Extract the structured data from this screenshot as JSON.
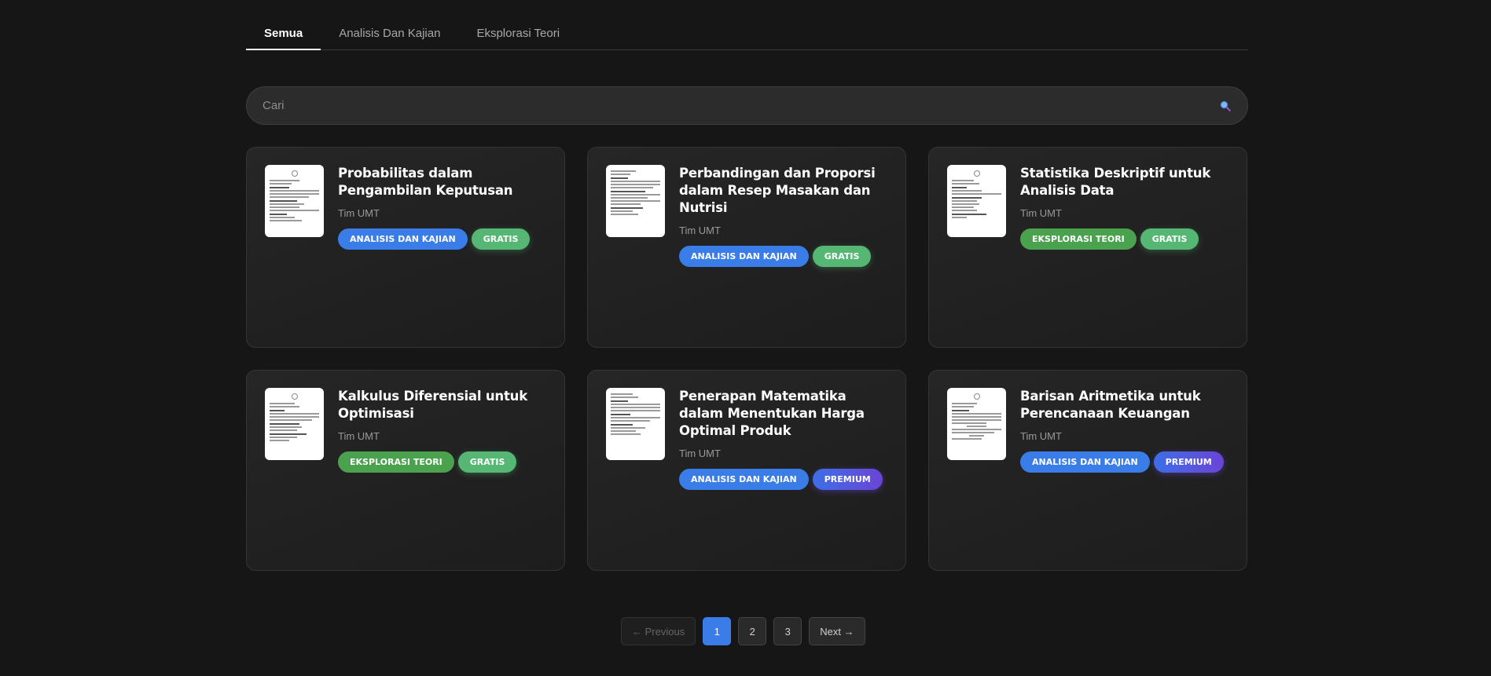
{
  "tabs": [
    {
      "label": "Semua"
    },
    {
      "label": "Analisis Dan Kajian"
    },
    {
      "label": "Eksplorasi Teori"
    }
  ],
  "search": {
    "placeholder": "Cari"
  },
  "cards": [
    {
      "title": "Probabilitas dalam Pengambilan Keputusan",
      "author": "Tim UMT",
      "category": "ANALISIS DAN KAJIAN",
      "price": "GRATIS"
    },
    {
      "title": "Perbandingan dan Proporsi dalam Resep Masakan dan Nutrisi",
      "author": "Tim UMT",
      "category": "ANALISIS DAN KAJIAN",
      "price": "GRATIS"
    },
    {
      "title": "Statistika Deskriptif untuk Analisis Data",
      "author": "Tim UMT",
      "category": "EKSPLORASI TEORI",
      "price": "GRATIS"
    },
    {
      "title": "Kalkulus Diferensial untuk Optimisasi",
      "author": "Tim UMT",
      "category": "EKSPLORASI TEORI",
      "price": "GRATIS"
    },
    {
      "title": "Penerapan Matematika dalam Menentukan Harga Optimal Produk",
      "author": "Tim UMT",
      "category": "ANALISIS DAN KAJIAN",
      "price": "PREMIUM"
    },
    {
      "title": "Barisan Aritmetika untuk Perencanaan Keuangan",
      "author": "Tim UMT",
      "category": "ANALISIS DAN KAJIAN",
      "price": "PREMIUM"
    }
  ],
  "pagination": {
    "previous": "← Previous",
    "pages": [
      "1",
      "2",
      "3"
    ],
    "next": "Next →",
    "current": "1"
  },
  "colors": {
    "accent": "#3a7de8",
    "eksplorasi": "#4aa24f",
    "gratis": "#56b774",
    "premium": "#6a44d6"
  }
}
